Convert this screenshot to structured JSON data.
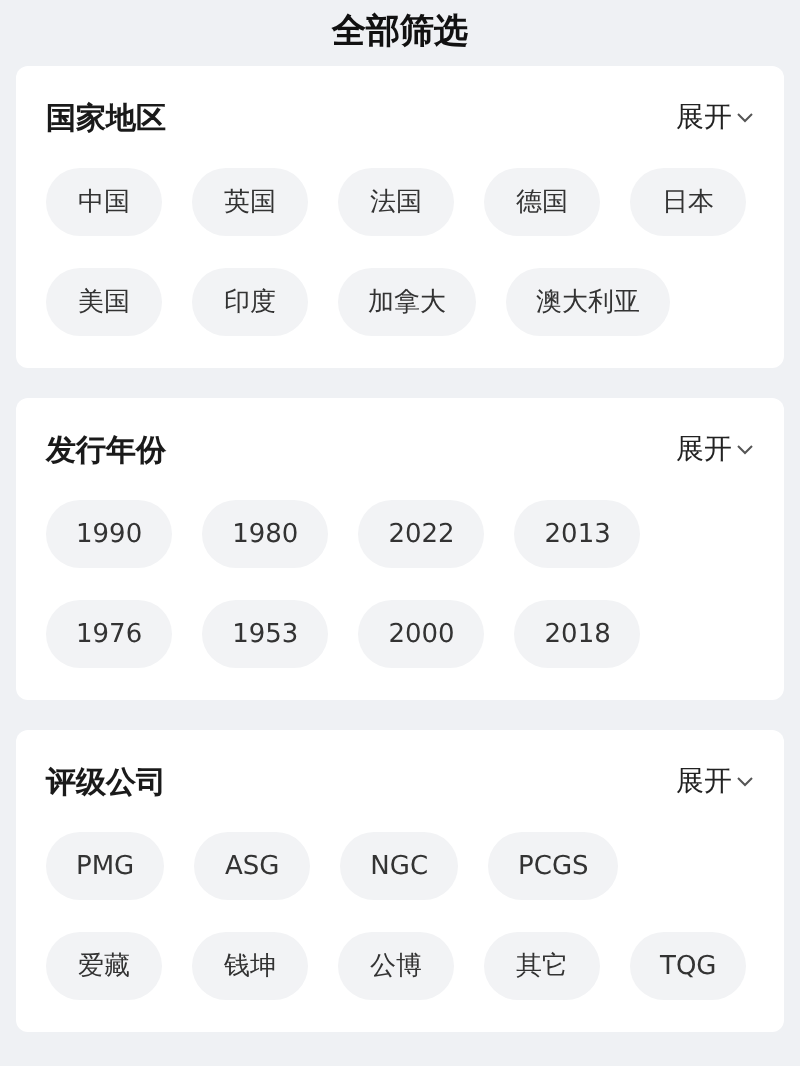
{
  "title": "全部筛选",
  "sections": [
    {
      "heading": "国家地区",
      "toggle": "展开",
      "options": [
        "中国",
        "英国",
        "法国",
        "德国",
        "日本",
        "美国",
        "印度",
        "加拿大",
        "澳大利亚"
      ]
    },
    {
      "heading": "发行年份",
      "toggle": "展开",
      "options": [
        "1990",
        "1980",
        "2022",
        "2013",
        "1976",
        "1953",
        "2000",
        "2018"
      ]
    },
    {
      "heading": "评级公司",
      "toggle": "展开",
      "options": [
        "PMG",
        "ASG",
        "NGC",
        "PCGS",
        "爱藏",
        "钱坤",
        "公博",
        "其它",
        "TQG"
      ]
    }
  ]
}
